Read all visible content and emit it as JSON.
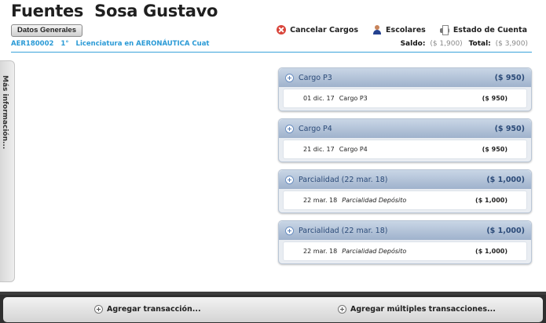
{
  "student": {
    "name": "Fuentes  Sosa Gustavo",
    "id": "AER180002",
    "grade": "1°",
    "program": "Licenciatura en AERONÁUTICA Cuat"
  },
  "header": {
    "datos_label": "Datos Generales",
    "actions": [
      {
        "label": "Cancelar Cargos",
        "icon": "cancel-icon"
      },
      {
        "label": "Escolares",
        "icon": "student-icon"
      },
      {
        "label": "Estado de Cuenta",
        "icon": "printer-icon"
      }
    ],
    "balance": {
      "saldo_label": "Saldo:",
      "saldo_value": "($ 1,900)",
      "total_label": "Total:",
      "total_value": "($ 3,900)"
    }
  },
  "side_tab": {
    "label": "Más información..."
  },
  "transactions": [
    {
      "title": "Cargo P3",
      "amount": "($ 950)",
      "date": "01 dic. 17",
      "description": "Cargo P3",
      "italic": false,
      "line_amount": "($ 950)"
    },
    {
      "title": "Cargo P4",
      "amount": "($ 950)",
      "date": "21 dic. 17",
      "description": "Cargo P4",
      "italic": false,
      "line_amount": "($ 950)"
    },
    {
      "title": "Parcialidad (22 mar. 18)",
      "amount": "($ 1,000)",
      "date": "22 mar. 18",
      "description": "Parcialidad Depósito",
      "italic": true,
      "line_amount": "($ 1,000)"
    },
    {
      "title": "Parcialidad (22 mar. 18)",
      "amount": "($ 1,000)",
      "date": "22 mar. 18",
      "description": "Parcialidad Depósito",
      "italic": true,
      "line_amount": "($ 1,000)"
    }
  ],
  "footer": {
    "add_label": "Agregar transacción...",
    "add_multiple_label": "Agregar múltiples transacciones..."
  }
}
